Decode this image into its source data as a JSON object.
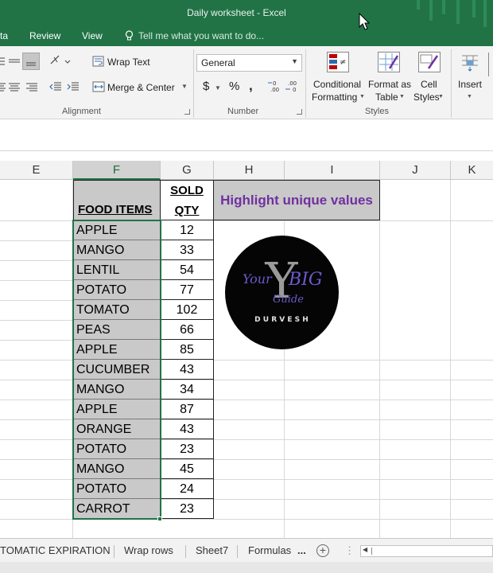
{
  "app": {
    "title": "Daily worksheet - Excel",
    "theme_color": "#217346"
  },
  "ribbon_tabs": {
    "data_tab_partial": "ta",
    "review": "Review",
    "view": "View",
    "tell_me": "Tell me what you want to do..."
  },
  "ribbon": {
    "wrap_text": "Wrap Text",
    "merge_center": "Merge & Center",
    "number_format": "General",
    "currency_symbol": "$",
    "percent_symbol": "%",
    "comma_symbol": ",",
    "conditional_formatting_line1": "Conditional",
    "conditional_formatting_line2": "Formatting",
    "format_as_table_line1": "Format as",
    "format_as_table_line2": "Table",
    "cell_styles_line1": "Cell",
    "cell_styles_line2": "Styles",
    "insert": "Insert",
    "group_alignment": "Alignment",
    "group_number": "Number",
    "group_styles": "Styles"
  },
  "columns": [
    "E",
    "F",
    "G",
    "H",
    "I",
    "J",
    "K"
  ],
  "table": {
    "header_food": "FOOD ITEMS",
    "header_sold": "SOLD",
    "header_qty": "QTY",
    "note": "Highlight unique values",
    "rows": [
      {
        "item": "APPLE",
        "qty": "12"
      },
      {
        "item": "MANGO",
        "qty": "33"
      },
      {
        "item": "LENTIL",
        "qty": "54"
      },
      {
        "item": "POTATO",
        "qty": "77"
      },
      {
        "item": "TOMATO",
        "qty": "102"
      },
      {
        "item": "PEAS",
        "qty": "66"
      },
      {
        "item": "APPLE",
        "qty": "85"
      },
      {
        "item": "CUCUMBER",
        "qty": "43"
      },
      {
        "item": "MANGO",
        "qty": "34"
      },
      {
        "item": "APPLE",
        "qty": "87"
      },
      {
        "item": "ORANGE",
        "qty": "43"
      },
      {
        "item": "POTATO",
        "qty": "23"
      },
      {
        "item": "MANGO",
        "qty": "45"
      },
      {
        "item": "POTATO",
        "qty": "24"
      },
      {
        "item": "CARROT",
        "qty": "23"
      }
    ]
  },
  "logo": {
    "big_letter": "Y",
    "script_your": "Your",
    "script_big": "BIG",
    "script_guide": "Guide",
    "name": "D U R V E S H"
  },
  "sheet_tabs": {
    "tab1": "TOMATIC EXPIRATION",
    "tab2": "Wrap rows",
    "tab3": "Sheet7",
    "tab4": "Formulas",
    "more": "...",
    "add_symbol": "+"
  }
}
